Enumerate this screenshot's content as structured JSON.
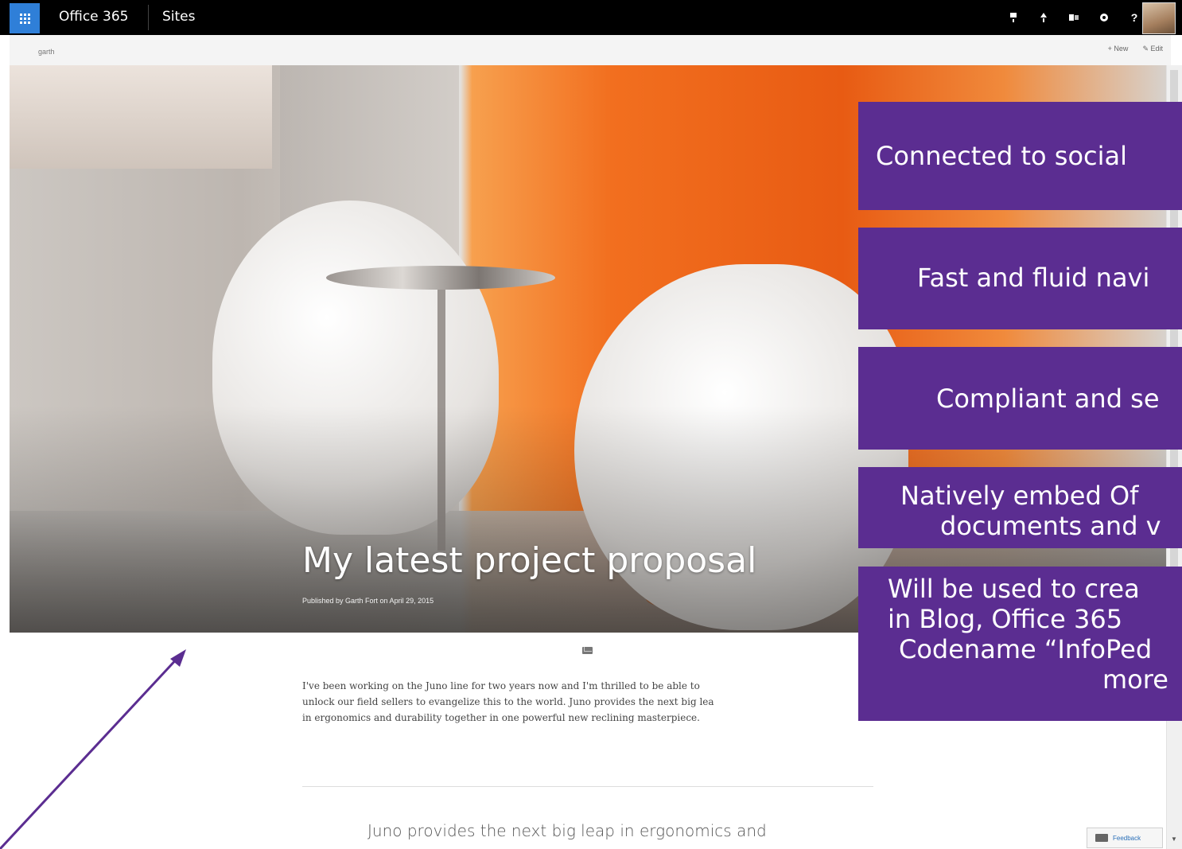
{
  "suite_bar": {
    "brand": "Office 365",
    "app": "Sites",
    "icons": [
      "notifications-icon",
      "upload-icon",
      "outlook-icon",
      "settings-icon",
      "help-icon"
    ],
    "help_label": "?"
  },
  "site_bar": {
    "site_name": "garth",
    "new_label": "+ New",
    "edit_label": "✎ Edit"
  },
  "post": {
    "title": "My latest project proposal",
    "byline": "Published by Garth Fort on April 29, 2015",
    "paragraph_lines": [
      "I've been working on the Juno line for two years now and I'm thrilled to be able to",
      "unlock our field sellers to evangelize this to the world.  Juno provides the next big lea",
      "in ergonomics and durability together in one powerful new reclining masterpiece."
    ],
    "pull_quote": "Juno provides the next big leap in ergonomics and"
  },
  "feedback": {
    "label": "Feedback"
  },
  "callouts": [
    {
      "lines": [
        "Connected to social"
      ]
    },
    {
      "lines": [
        "Fast and fluid navi"
      ]
    },
    {
      "lines": [
        "Compliant and se"
      ]
    },
    {
      "lines": [
        "Natively embed Of",
        "documents and v"
      ]
    },
    {
      "lines": [
        "Will be used to crea",
        "in Blog, Office 365",
        "Codename “InfoPed",
        "more"
      ]
    }
  ],
  "colors": {
    "suite_bar": "#000000",
    "waffle": "#2f7fd8",
    "callout": "#5b2d91",
    "arrow": "#5b2d91"
  }
}
